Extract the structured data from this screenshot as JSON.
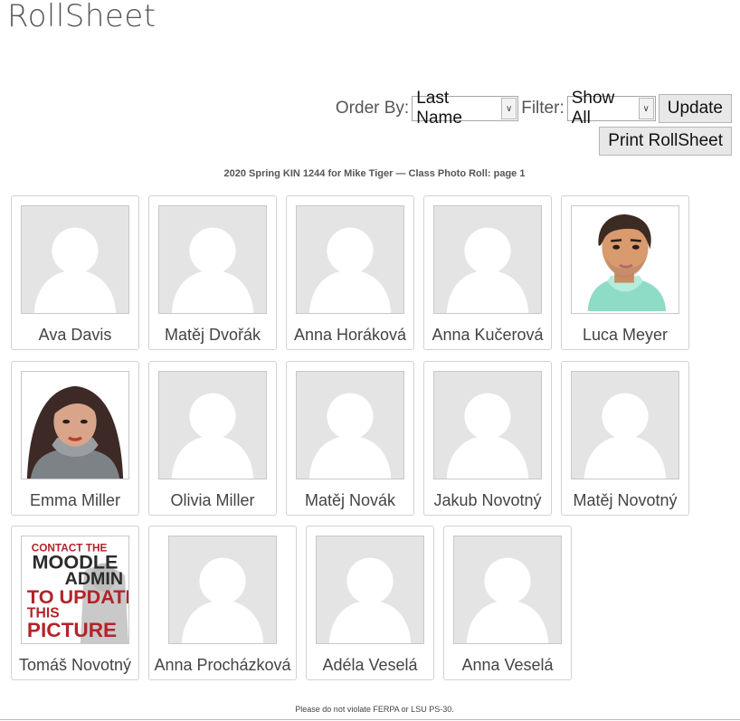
{
  "app": {
    "title": "RollSheet"
  },
  "controls": {
    "order_by_label": "Order By:",
    "order_by_value": "Last Name",
    "filter_label": "Filter:",
    "filter_value": "Show All",
    "update_label": "Update",
    "print_label": "Print RollSheet"
  },
  "roll": {
    "title": "2020 Spring KIN 1244 for Mike Tiger — Class Photo Roll: page 1"
  },
  "students": [
    {
      "name": "Ava Davis",
      "photo": "placeholder-avatar-icon"
    },
    {
      "name": "Matěj Dvořák",
      "photo": "placeholder-avatar-icon"
    },
    {
      "name": "Anna Horáková",
      "photo": "placeholder-avatar-icon"
    },
    {
      "name": "Anna Kučerová",
      "photo": "placeholder-avatar-icon"
    },
    {
      "name": "Luca Meyer",
      "photo": "man-portrait-icon"
    },
    {
      "name": "Emma Miller",
      "photo": "woman-portrait-icon"
    },
    {
      "name": "Olivia Miller",
      "photo": "placeholder-avatar-icon"
    },
    {
      "name": "Matěj Novák",
      "photo": "placeholder-avatar-icon"
    },
    {
      "name": "Jakub Novotný",
      "photo": "placeholder-avatar-icon"
    },
    {
      "name": "Matěj Novotný",
      "photo": "placeholder-avatar-icon"
    },
    {
      "name": "Tomáš Novotný",
      "photo": "contact-admin-notice-icon",
      "photo_text": [
        "CONTACT THE",
        "MOODLE",
        "ADMIN",
        "TO UPDATE",
        "THIS",
        "PICTURE"
      ]
    },
    {
      "name": "Anna Procházková",
      "photo": "placeholder-avatar-icon"
    },
    {
      "name": "Adéla Veselá",
      "photo": "placeholder-avatar-icon"
    },
    {
      "name": "Anna Veselá",
      "photo": "placeholder-avatar-icon"
    }
  ],
  "footer": {
    "notice": "Please do not violate FERPA or LSU PS-30."
  }
}
